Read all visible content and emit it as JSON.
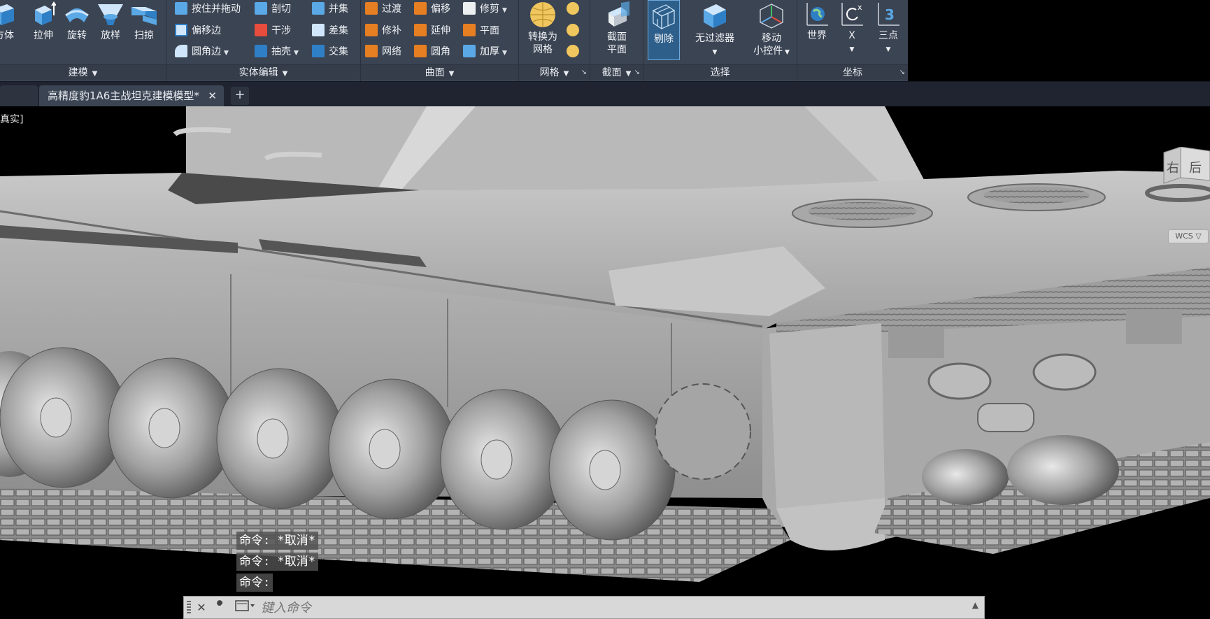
{
  "colors": {
    "ribbon_bg": "#3b4453",
    "panel_title_bg": "#353d4a",
    "accent": "#2e5f8a",
    "viewport_bg": "#000000",
    "model_gray": "#a9a9a9"
  },
  "ribbon": {
    "modeling": {
      "title": "建模",
      "buttons": [
        {
          "label": "方体",
          "icon": "box-icon"
        },
        {
          "label": "拉伸",
          "icon": "extrude-icon"
        },
        {
          "label": "旋转",
          "icon": "revolve-icon"
        },
        {
          "label": "放样",
          "icon": "loft-icon"
        },
        {
          "label": "扫掠",
          "icon": "sweep-icon"
        }
      ]
    },
    "solid_edit": {
      "title": "实体编辑",
      "col1": [
        "按住并拖动",
        "偏移边",
        "圆角边"
      ],
      "col2": [
        "剖切",
        "干涉",
        "抽壳"
      ],
      "col3": [
        "并集",
        "差集",
        "交集"
      ]
    },
    "surface": {
      "title": "曲面",
      "col1": [
        "过渡",
        "修补",
        "网络"
      ],
      "col2": [
        "偏移",
        "延伸",
        "圆角"
      ],
      "col3": [
        "修剪",
        "平面",
        "加厚"
      ]
    },
    "mesh": {
      "title": "网格",
      "convert_label_1": "转换为",
      "convert_label_2": "网格"
    },
    "section": {
      "title": "截面",
      "btn_label_1": "截面",
      "btn_label_2": "平面"
    },
    "selection": {
      "title": "选择",
      "cull_label": "剔除",
      "filter_label": "无过滤器",
      "gizmo_label_1": "移动",
      "gizmo_label_2": "小控件"
    },
    "coordinates": {
      "title": "坐标",
      "buttons": [
        {
          "label": "世界",
          "icon": "globe-icon"
        },
        {
          "label": "X",
          "icon": "ucs-x-rotate-icon"
        },
        {
          "label": "三点",
          "icon": "ucs-3point-icon",
          "badge": "3"
        }
      ]
    }
  },
  "tabs": {
    "active": "高精度豹1A6主战坦克建模模型*",
    "new_tab_symbol": "+",
    "close_symbol": "✕"
  },
  "viewport": {
    "visual_style_label": "真实]",
    "viewcube_faces": [
      "右",
      "后"
    ],
    "wcs_label": "WCS ▽"
  },
  "command_history": [
    "命令: *取消*",
    "命令: *取消*",
    "命令:"
  ],
  "command_line": {
    "placeholder": "键入命令"
  }
}
